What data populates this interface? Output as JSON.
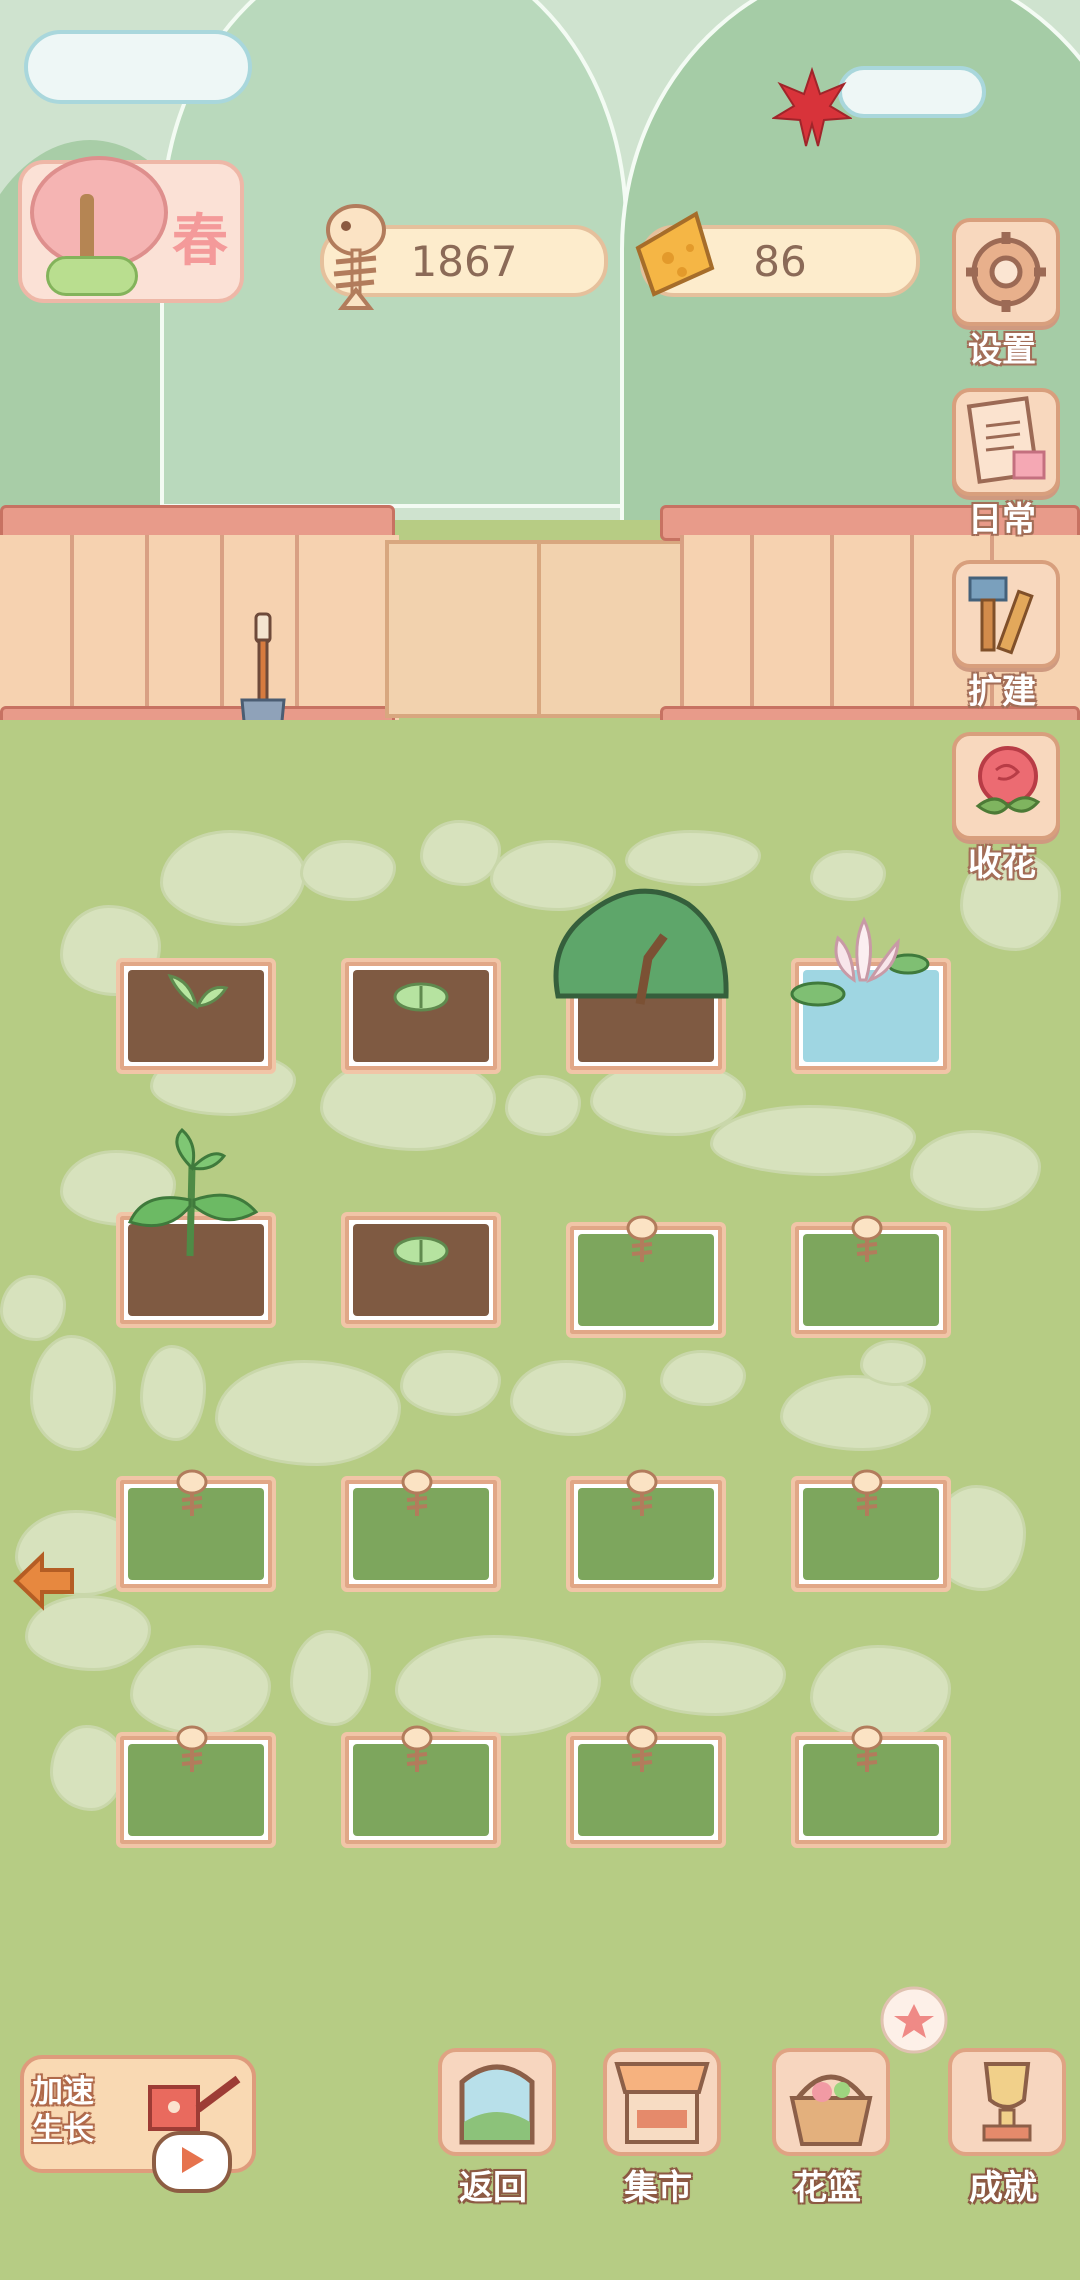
{
  "hud": {
    "season_label": "春",
    "fish_count": "1867",
    "cheese_count": "86"
  },
  "side_menu": {
    "settings": "设置",
    "daily": "日常",
    "expand": "扩建",
    "collect_flowers": "收花"
  },
  "garden": {
    "rows": [
      [
        "sprout",
        "seed",
        "bush",
        "lotus-pond"
      ],
      [
        "seedling",
        "seed",
        "grass-locked",
        "grass-locked"
      ],
      [
        "grass-locked",
        "grass-locked",
        "grass-locked",
        "grass-locked"
      ],
      [
        "grass-locked",
        "grass-locked",
        "grass-locked",
        "grass-locked"
      ]
    ]
  },
  "bottom_bar": {
    "speed_up": "加速生长",
    "back": "返回",
    "market": "集市",
    "basket": "花篮",
    "achievements": "成就"
  },
  "colors": {
    "grass": "#b6cc84",
    "accent": "#e6734e",
    "soil": "#7f5a42"
  },
  "icons": {
    "season": "cherry-tree-icon",
    "fish": "fishbone-icon",
    "cheese": "cheese-icon",
    "settings": "gear-icon",
    "daily": "memo-icon",
    "expand": "tools-icon",
    "collect": "rose-icon",
    "back": "window-icon",
    "market": "stall-icon",
    "basket": "basket-icon",
    "achievement": "trophy-icon",
    "left": "arrow-left-icon"
  }
}
